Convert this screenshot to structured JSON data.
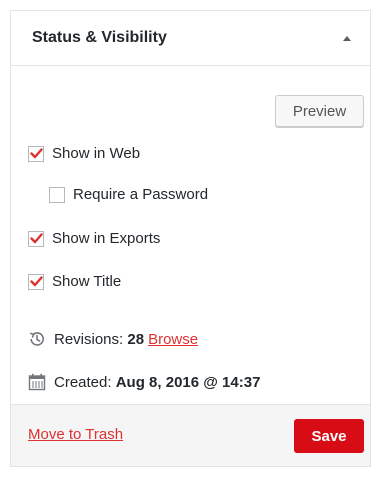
{
  "panel": {
    "title": "Status & Visibility",
    "toggle_icon": "caret-up-icon"
  },
  "actions": {
    "preview_label": "Preview"
  },
  "options": [
    {
      "label": "Show in Web",
      "checked": true
    },
    {
      "label": "Require a Password",
      "checked": false
    },
    {
      "label": "Show in Exports",
      "checked": true
    },
    {
      "label": "Show Title",
      "checked": true
    }
  ],
  "revisions": {
    "icon": "history-icon",
    "label": "Revisions:",
    "count": "28",
    "browse_label": "Browse"
  },
  "created": {
    "icon": "calendar-icon",
    "label": "Created:",
    "value": "Aug 8, 2016 @ 14:37"
  },
  "footer": {
    "trash_label": "Move to Trash",
    "save_label": "Save"
  },
  "colors": {
    "accent": "#d70c14",
    "link": "#dc3232",
    "check": "#dc3232"
  }
}
